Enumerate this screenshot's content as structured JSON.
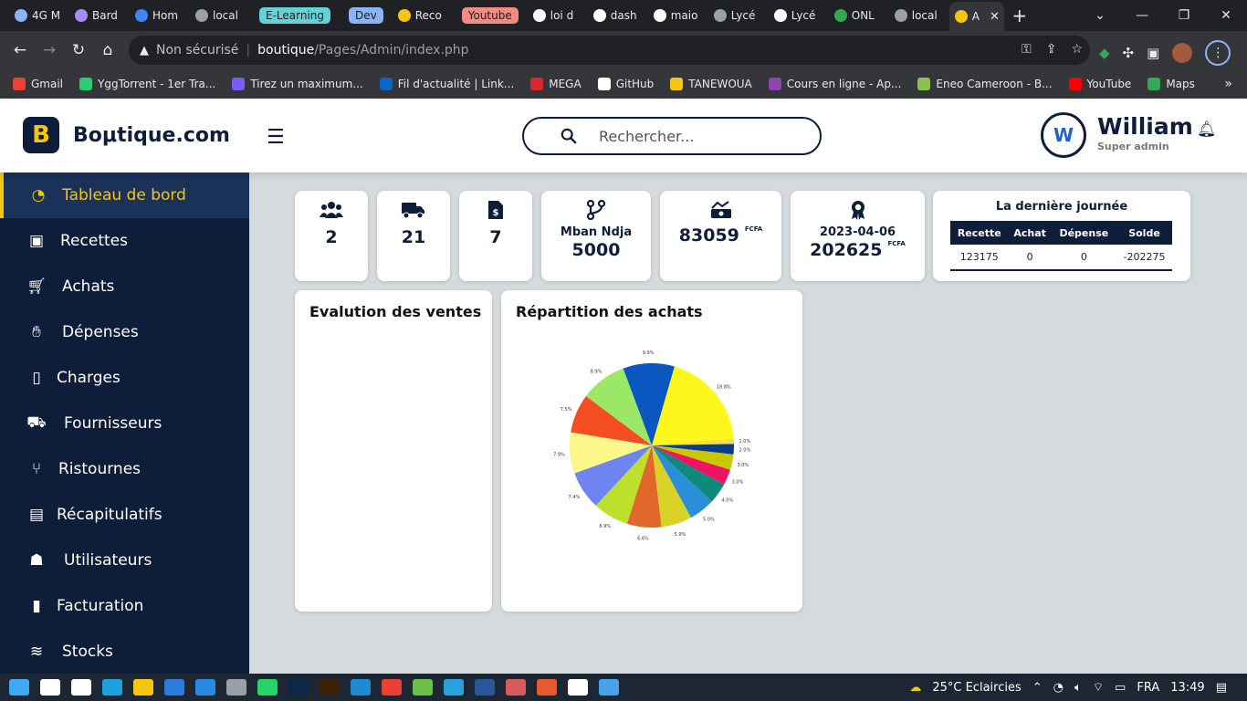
{
  "browser": {
    "tabs": [
      {
        "label": "4G M",
        "icon": "globe-icon",
        "color": "#8ab4f8"
      },
      {
        "label": "Bard",
        "icon": "bard-icon",
        "color": "#a78bfa"
      },
      {
        "label": "Hom",
        "icon": "home-icon",
        "color": "#4285f4"
      },
      {
        "label": "local",
        "icon": "sail-icon",
        "color": "#9aa0a6"
      },
      {
        "label": "E-Learning",
        "icon": "",
        "color": "#63d2d6",
        "pill": true,
        "pill_bg": "#63d2d6",
        "pill_fg": "#202124"
      },
      {
        "label": "Dev",
        "icon": "",
        "color": "#8ab4f8",
        "pill": true,
        "pill_bg": "#8ab4f8",
        "pill_fg": "#202124"
      },
      {
        "label": "Reco",
        "icon": "g-icon",
        "color": "#f6c514"
      },
      {
        "label": "Youtube",
        "icon": "",
        "color": "#f28b82",
        "pill": true,
        "pill_bg": "#f28b82",
        "pill_fg": "#202124"
      },
      {
        "label": "loi d",
        "icon": "google-icon",
        "color": "#ffffff"
      },
      {
        "label": "dash",
        "icon": "google-icon",
        "color": "#ffffff"
      },
      {
        "label": "maio",
        "icon": "google-icon",
        "color": "#ffffff"
      },
      {
        "label": "Lycé",
        "icon": "globe-icon",
        "color": "#9aa0a6"
      },
      {
        "label": "Lycé",
        "icon": "google-icon",
        "color": "#ffffff"
      },
      {
        "label": "ONL",
        "icon": "layers-icon",
        "color": "#34a853"
      },
      {
        "label": "local",
        "icon": "w-icon",
        "color": "#9aa0a6"
      },
      {
        "label": "A",
        "icon": "boutique-icon",
        "color": "#f6c514",
        "active": true
      }
    ],
    "new_tab": "+",
    "address": {
      "warning": "Non sécurisé",
      "domain": "boutique",
      "path": "/Pages/Admin/index.php"
    },
    "bookmarks": [
      {
        "label": "Gmail",
        "color": "#ea4335"
      },
      {
        "label": "YggTorrent - 1er Tra...",
        "color": "#2ecc71"
      },
      {
        "label": "Tirez un maximum...",
        "color": "#7b5cf5"
      },
      {
        "label": "Fil d'actualité | Link...",
        "color": "#0a66c2"
      },
      {
        "label": "MEGA",
        "color": "#d9272e"
      },
      {
        "label": "GitHub",
        "color": "#ffffff"
      },
      {
        "label": "TANEWOUA",
        "color": "#f6c514"
      },
      {
        "label": "Cours en ligne - Ap...",
        "color": "#8e44ad"
      },
      {
        "label": "Eneo Cameroon - B...",
        "color": "#8bc34a"
      },
      {
        "label": "YouTube",
        "color": "#ff0000"
      },
      {
        "label": "Maps",
        "color": "#34a853"
      }
    ]
  },
  "header": {
    "logo_letter": "B",
    "brand": "Boμtique.com",
    "search_placeholder": "Rechercher...",
    "user": {
      "name": "William",
      "role": "Super admin",
      "initials": "W"
    }
  },
  "sidebar": {
    "items": [
      {
        "label": "Tableau de bord",
        "icon": "dashboard-icon",
        "active": true
      },
      {
        "label": "Recettes",
        "icon": "money-icon"
      },
      {
        "label": "Achats",
        "icon": "cart-icon"
      },
      {
        "label": "Dépenses",
        "icon": "hand-money-icon"
      },
      {
        "label": "Charges",
        "icon": "invoice-icon"
      },
      {
        "label": "Fournisseurs",
        "icon": "truck-icon"
      },
      {
        "label": "Ristournes",
        "icon": "branch-icon"
      },
      {
        "label": "Récapitulatifs",
        "icon": "clipboard-icon"
      },
      {
        "label": "Utilisateurs",
        "icon": "users-icon"
      },
      {
        "label": "Facturation",
        "icon": "file-icon"
      },
      {
        "label": "Stocks",
        "icon": "layers-icon"
      }
    ]
  },
  "stats": [
    {
      "icon": "users-icon",
      "value": "2"
    },
    {
      "icon": "truck-icon",
      "value": "21"
    },
    {
      "icon": "invoice-icon",
      "value": "7"
    },
    {
      "icon": "branch-icon",
      "label": "Mban Ndja",
      "value": "5000"
    },
    {
      "icon": "money-icon",
      "value": "83059",
      "unit": "FCFA"
    },
    {
      "icon": "award-icon",
      "label": "2023-04-06",
      "value": "202625",
      "unit": "FCFA"
    }
  ],
  "last_day": {
    "title": "La dernière journée",
    "columns": [
      "Recette",
      "Achat",
      "Dépense",
      "Solde"
    ],
    "row": [
      "123175",
      "0",
      "0",
      "-202275"
    ]
  },
  "sales_card": {
    "title": "Evalution des ventes"
  },
  "purchases_card": {
    "title": "Répartition des achats"
  },
  "chart_data": {
    "type": "pie",
    "title": "Répartition des achats",
    "values": [
      18.8,
      1.0,
      2.0,
      3.0,
      3.0,
      4.0,
      5.0,
      5.9,
      6.6,
      6.9,
      7.4,
      7.9,
      7.5,
      8.9,
      9.9
    ],
    "labels": [
      "18.8%",
      "1.0%",
      "2.0%",
      "3.0%",
      "3.0%",
      "4.0%",
      "5.0%",
      "5.9%",
      "6.6%",
      "6.9%",
      "7.4%",
      "7.9%",
      "7.5%",
      "8.9%",
      "9.9%"
    ],
    "colors": [
      "#fdf71c",
      "#f0e04a",
      "#0b3c8c",
      "#c8c800",
      "#ee1463",
      "#0d8a7a",
      "#2b8fd8",
      "#d9d226",
      "#e0682a",
      "#bde02c",
      "#6e84f0",
      "#fbf78a",
      "#f44d22",
      "#9be866",
      "#0a57c0"
    ]
  },
  "taskbar": {
    "weather": "25°C  Eclaircies",
    "language": "FRA",
    "time": "13:49",
    "apps": [
      {
        "icon": "windows-icon",
        "color": "#3fa9f5"
      },
      {
        "icon": "search-icon",
        "color": "#ffffff"
      },
      {
        "icon": "task-view-icon",
        "color": "#ffffff"
      },
      {
        "icon": "edge-icon",
        "color": "#1fa1e0"
      },
      {
        "icon": "explorer-icon",
        "color": "#f6c514"
      },
      {
        "icon": "store-icon",
        "color": "#2b7bd8"
      },
      {
        "icon": "mail-icon",
        "color": "#2a89e0"
      },
      {
        "icon": "photos-icon",
        "color": "#9aa0a6"
      },
      {
        "icon": "whatsapp-icon",
        "color": "#25d366"
      },
      {
        "icon": "photoshop-icon",
        "color": "#0c2748"
      },
      {
        "icon": "illustrator-icon",
        "color": "#3c1f06"
      },
      {
        "icon": "vscode-icon",
        "color": "#1f8ad2"
      },
      {
        "icon": "chrome-icon",
        "color": "#e94235"
      },
      {
        "icon": "utorrent-icon",
        "color": "#6cc04a"
      },
      {
        "icon": "telegram-icon",
        "color": "#2aa1db"
      },
      {
        "icon": "word-icon",
        "color": "#2b579a"
      },
      {
        "icon": "app-icon",
        "color": "#d85a5a"
      },
      {
        "icon": "mlflow-icon",
        "color": "#e85a2e"
      },
      {
        "icon": "settings-icon",
        "color": "#ffffff"
      },
      {
        "icon": "paint-icon",
        "color": "#4aa3e8"
      }
    ]
  }
}
